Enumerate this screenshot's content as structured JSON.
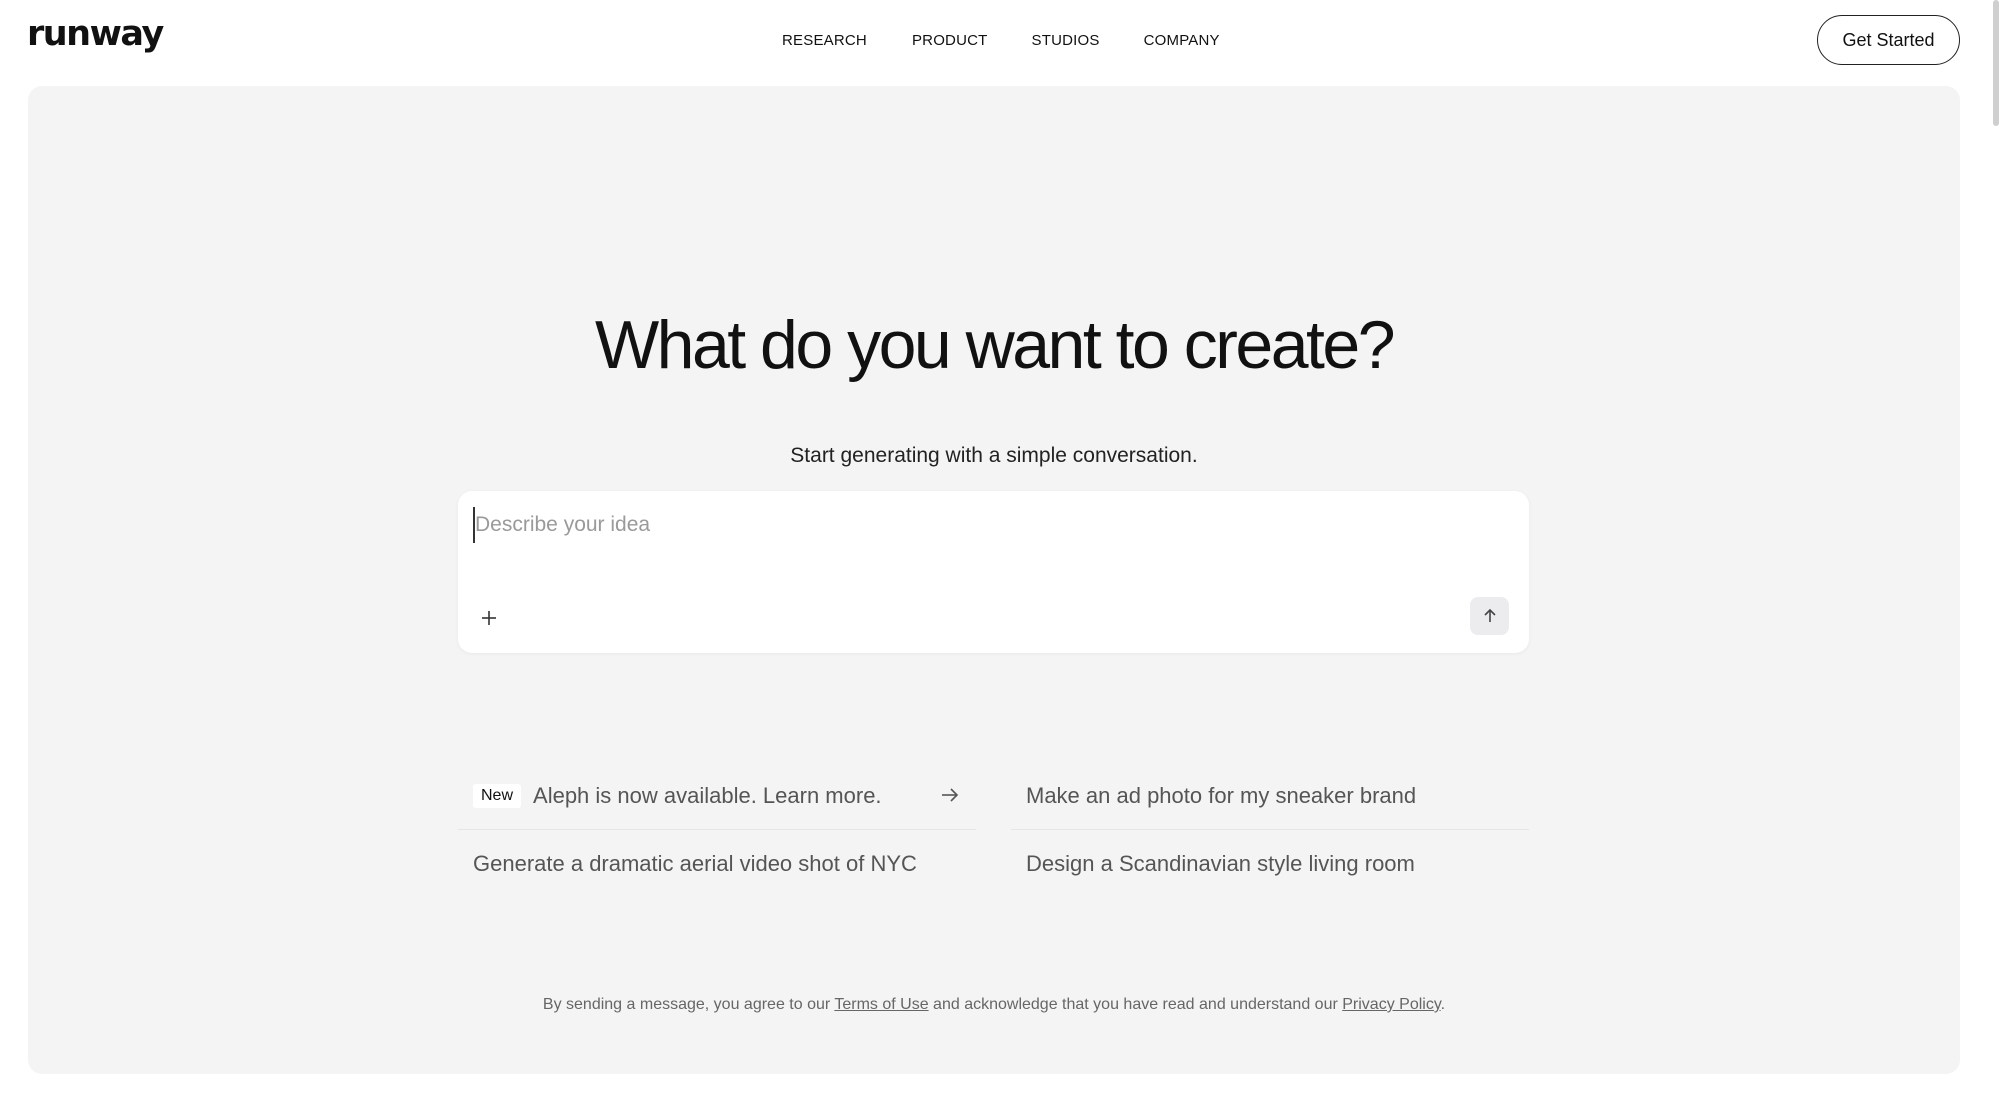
{
  "header": {
    "logo": "runway",
    "nav": [
      "RESEARCH",
      "PRODUCT",
      "STUDIOS",
      "COMPANY"
    ],
    "cta": "Get Started"
  },
  "hero": {
    "title": "What do you want to create?",
    "subtitle": "Start generating with a simple conversation."
  },
  "prompt": {
    "placeholder": "Describe your idea",
    "value": ""
  },
  "suggestions": {
    "badge": "New",
    "items": [
      "Aleph is now available. Learn more.",
      "Make an ad photo for my sneaker brand",
      "Generate a dramatic aerial video shot of NYC",
      "Design a Scandinavian style living room"
    ]
  },
  "footer": {
    "text_1": "By sending a message, you agree to our ",
    "terms": "Terms of Use",
    "text_2": " and acknowledge that you have read and understand our ",
    "privacy": "Privacy Policy",
    "text_3": "."
  },
  "icons": {
    "plus": "plus-icon",
    "send": "arrow-up-icon",
    "arrow": "arrow-right-icon"
  }
}
